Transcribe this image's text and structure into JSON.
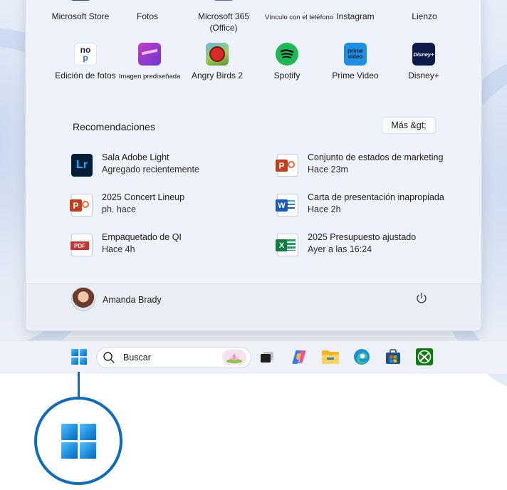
{
  "pinned_apps": [
    {
      "label": "Microsoft Store",
      "icon": "store-icon"
    },
    {
      "label": "Fotos",
      "icon": "photos-icon"
    },
    {
      "label": "Microsoft 365\n(Office)",
      "icon": "office-icon"
    },
    {
      "label": "Vínculo con el teléfono",
      "icon": "phone-link-icon"
    },
    {
      "label": "Instagram",
      "icon": "instagram-icon"
    },
    {
      "label": "Lienzo",
      "icon": "canvas-icon"
    },
    {
      "label": "Edición de fotos",
      "icon": "photo-editor-icon"
    },
    {
      "label": "Imagen prediseñada",
      "icon": "clipchamp-icon"
    },
    {
      "label": "Angry Birds 2",
      "icon": "angry-birds-icon"
    },
    {
      "label": "Spotify",
      "icon": "spotify-icon"
    },
    {
      "label": "Prime Video",
      "icon": "prime-video-icon"
    },
    {
      "label": "Disney+",
      "icon": "disney-plus-icon"
    }
  ],
  "icon_text": {
    "photo_editor_top": "no",
    "photo_editor_bottom": "p",
    "prime_video": "prime\nvideo",
    "disney": "Disney+",
    "lightroom": "Lr",
    "pdf": "PDF",
    "powerpoint": "P",
    "word": "W",
    "excel": "X"
  },
  "recommendations": {
    "title": "Recomendaciones",
    "more_button": "Más &gt;",
    "items": [
      {
        "name": "Sala Adobe Light",
        "time": "Agregado recientemente",
        "icon": "lightroom-icon"
      },
      {
        "name": "Conjunto de estados de marketing",
        "time": "Hace 23m",
        "icon": "powerpoint-icon"
      },
      {
        "name": "2025 Concert Lineup",
        "time": "ph. hace",
        "icon": "powerpoint-icon"
      },
      {
        "name": "Carta de presentación inapropiada",
        "time": "Hace 2h",
        "icon": "word-icon"
      },
      {
        "name": "Empaquetado de QI",
        "time": "Hace 4h",
        "icon": "pdf-icon"
      },
      {
        "name": "2025 Presupuesto ajustado",
        "time": "Ayer a las 16:24",
        "icon": "excel-icon"
      }
    ]
  },
  "user": {
    "name": "Amanda Brady"
  },
  "taskbar": {
    "search_placeholder": "Buscar"
  },
  "colors": {
    "accent": "#0f6cbd",
    "powerpoint": "#c43e1c",
    "word": "#185abd",
    "excel": "#107c41",
    "pdf": "#d32f2f",
    "spotify": "#1db954"
  }
}
